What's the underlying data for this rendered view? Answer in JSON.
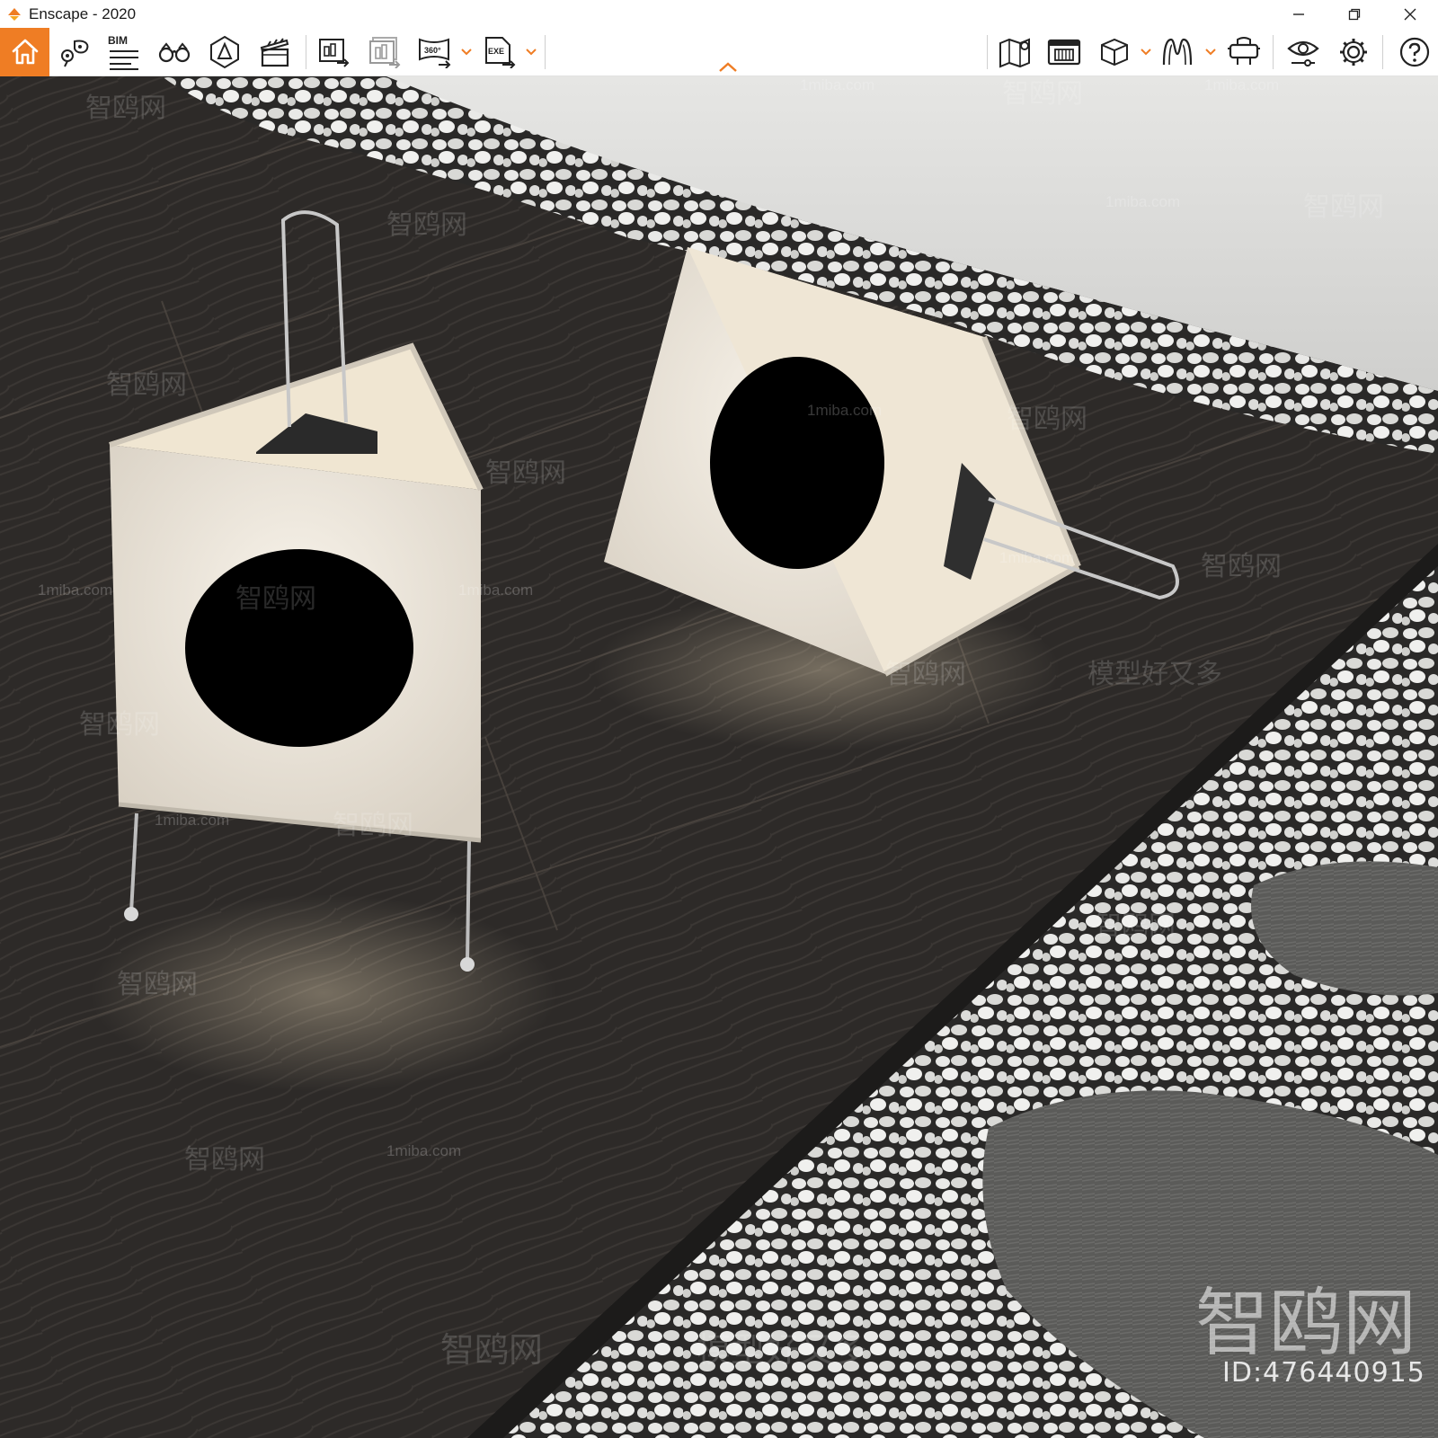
{
  "window": {
    "title": "Enscape - 2020",
    "controls": [
      "minimize",
      "restore",
      "close"
    ]
  },
  "toolbar": {
    "accent_color": "#ef7d24",
    "bim_label": "BIM",
    "pano_badge": "360°",
    "exe_badge": "EXE",
    "left_group": [
      "home-icon",
      "views-pin-icon",
      "bim-info-icon",
      "binoculars-icon",
      "light-view-icon",
      "video-editor-icon"
    ],
    "export_group": [
      "batch-render-icon",
      "render-queue-icon",
      "panorama-360-icon",
      "exe-standalone-icon"
    ],
    "right_group": [
      "map-icon",
      "asset-library-icon",
      "cube-view-icon",
      "material-editor-icon",
      "vr-headset-icon",
      "visual-settings-icon",
      "settings-icon",
      "help-icon"
    ]
  },
  "watermarks": {
    "site": "1miba.com",
    "brand": "智鸥网",
    "slogan": "模型好又多",
    "id_label": "ID:476440915"
  }
}
